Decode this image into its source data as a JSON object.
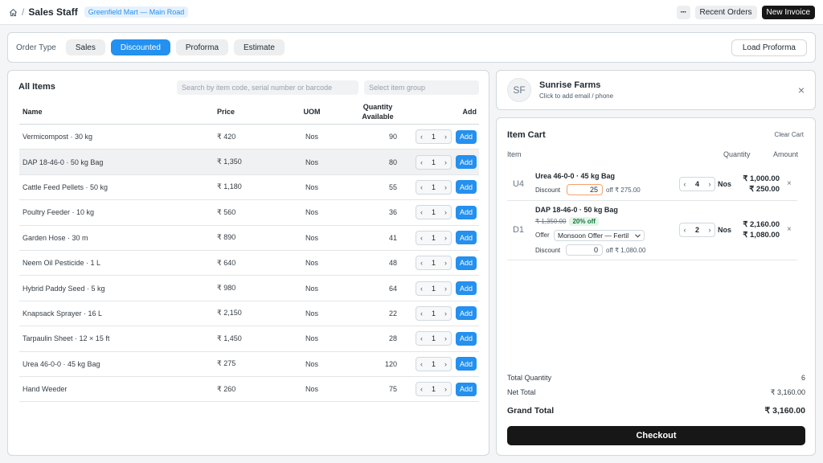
{
  "header": {
    "breadcrumb_sep": "/",
    "title": "Sales Staff",
    "branch": "Greenfield Mart — Main Road",
    "more_label": "···",
    "recent_orders": "Recent Orders",
    "new_invoice": "New Invoice"
  },
  "order_type": {
    "label": "Order Type",
    "options": [
      "Sales",
      "Discounted",
      "Proforma",
      "Estimate"
    ],
    "selected": "Discounted",
    "load_proforma": "Load Proforma"
  },
  "items": {
    "title": "All Items",
    "search_placeholder": "Search by item code, serial number or barcode",
    "group_placeholder": "Select item group",
    "columns": {
      "name": "Name",
      "price": "Price",
      "uom": "UOM",
      "qty_line1": "Quantity",
      "qty_line2": "Available",
      "add": "Add"
    },
    "add_label": "Add",
    "rows": [
      {
        "name": "Vermicompost · 30 kg",
        "price": "₹ 420",
        "uom": "Nos",
        "qty": "90",
        "step": "1"
      },
      {
        "name": "DAP 18-46-0 · 50 kg Bag",
        "price": "₹ 1,350",
        "uom": "Nos",
        "qty": "80",
        "step": "1"
      },
      {
        "name": "Cattle Feed Pellets · 50 kg",
        "price": "₹ 1,180",
        "uom": "Nos",
        "qty": "55",
        "step": "1"
      },
      {
        "name": "Poultry Feeder · 10 kg",
        "price": "₹ 560",
        "uom": "Nos",
        "qty": "36",
        "step": "1"
      },
      {
        "name": "Garden Hose · 30 m",
        "price": "₹ 890",
        "uom": "Nos",
        "qty": "41",
        "step": "1"
      },
      {
        "name": "Neem Oil Pesticide · 1 L",
        "price": "₹ 640",
        "uom": "Nos",
        "qty": "48",
        "step": "1"
      },
      {
        "name": "Hybrid Paddy Seed · 5 kg",
        "price": "₹ 980",
        "uom": "Nos",
        "qty": "64",
        "step": "1"
      },
      {
        "name": "Knapsack Sprayer · 16 L",
        "price": "₹ 2,150",
        "uom": "Nos",
        "qty": "22",
        "step": "1"
      },
      {
        "name": "Tarpaulin Sheet · 12 × 15 ft",
        "price": "₹ 1,450",
        "uom": "Nos",
        "qty": "28",
        "step": "1"
      },
      {
        "name": "Urea 46-0-0 · 45 kg Bag",
        "price": "₹ 275",
        "uom": "Nos",
        "qty": "120",
        "step": "1"
      },
      {
        "name": "Hand Weeder",
        "price": "₹ 260",
        "uom": "Nos",
        "qty": "75",
        "step": "1"
      }
    ]
  },
  "customer": {
    "initials": "SF",
    "name": "Sunrise Farms",
    "subtitle": "Click to add email / phone"
  },
  "cart": {
    "title": "Item Cart",
    "clear": "Clear Cart",
    "col_item": "Item",
    "col_qty": "Quantity",
    "col_amount": "Amount",
    "items": [
      {
        "abbr": "U4",
        "name": "Urea 46-0-0 · 45 kg Bag",
        "discount_label": "Discount",
        "discount_value": "25",
        "discount_off": "off ₹ 275.00",
        "qty": "4",
        "uom": "Nos",
        "amount": "₹ 1,000.00",
        "amount2": "₹ 250.00"
      },
      {
        "abbr": "D1",
        "name": "DAP 18-46-0 · 50 kg Bag",
        "orig_price": "₹ 1,350.00",
        "pct_off": "20% off",
        "offer_label": "Offer",
        "offer_value": "Monsoon Offer — Fertil",
        "discount_label": "Discount",
        "discount_value": "0",
        "discount_off": "off ₹ 1,080.00",
        "qty": "2",
        "uom": "Nos",
        "amount": "₹ 2,160.00",
        "amount2": "₹ 1,080.00"
      }
    ],
    "total_qty_label": "Total Quantity",
    "total_qty": "6",
    "net_total_label": "Net Total",
    "net_total": "₹ 3,160.00",
    "grand_total_label": "Grand Total",
    "grand_total": "₹ 3,160.00",
    "checkout": "Checkout"
  }
}
